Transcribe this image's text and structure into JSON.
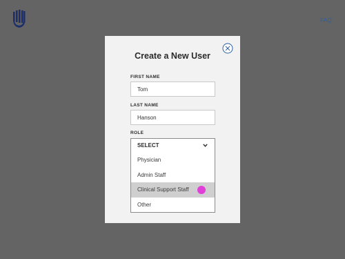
{
  "header": {
    "logo_icon": "shield-u-logo",
    "faq_label": "FAQ"
  },
  "modal": {
    "title": "Create a New User",
    "close_icon": "close-circle-icon",
    "first_name": {
      "label": "FIRST NAME",
      "value": "Tom"
    },
    "last_name": {
      "label": "LAST NAME",
      "value": "Hanson"
    },
    "role": {
      "label": "ROLE",
      "selected": "SELECT",
      "options": [
        "Physician",
        "Admin Staff",
        "Clinical Support Staff",
        "Other"
      ],
      "highlighted_option": "Clinical Support Staff"
    }
  },
  "colors": {
    "backdrop": "#646464",
    "accent": "#2a5fa0",
    "highlight": "#cfcfcf",
    "pointer": "#e040d8"
  }
}
